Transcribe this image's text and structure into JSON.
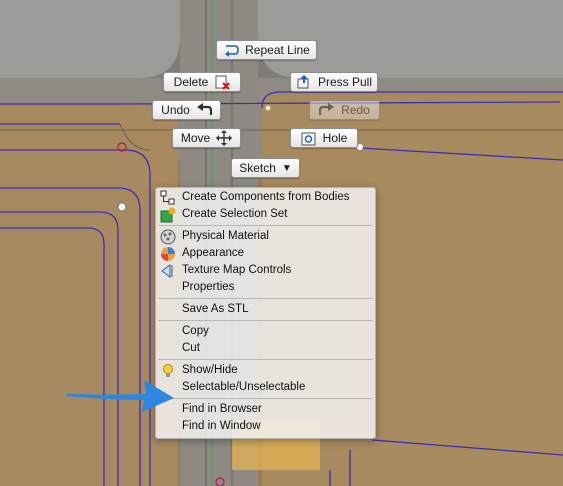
{
  "marking_menu": {
    "repeat_label": "Repeat Line",
    "delete_label": "Delete",
    "press_pull_label": "Press Pull",
    "undo_label": "Undo",
    "redo_label": "Redo",
    "move_label": "Move",
    "hole_label": "Hole",
    "sketch_label": "Sketch"
  },
  "context_menu": {
    "items": [
      {
        "label": "Create Components from Bodies",
        "icon": "components-icon"
      },
      {
        "label": "Create Selection Set",
        "icon": "selection-set-icon"
      },
      {
        "label": "Physical Material",
        "icon": "physical-material-icon"
      },
      {
        "label": "Appearance",
        "icon": "appearance-icon"
      },
      {
        "label": "Texture Map Controls",
        "icon": "texture-map-icon"
      },
      {
        "label": "Properties"
      },
      {
        "label": "Save As STL"
      },
      {
        "label": "Copy"
      },
      {
        "label": "Cut"
      },
      {
        "label": "Show/Hide",
        "icon": "lightbulb-icon"
      },
      {
        "label": "Selectable/Unselectable"
      },
      {
        "label": "Find in Browser"
      },
      {
        "label": "Find in Window"
      }
    ]
  },
  "colors": {
    "surface": "#a88a60",
    "edge_line": "#3a2fb0",
    "gray_fill": "#8d8c89",
    "arrow": "#2f86e0",
    "selection": "#e4b454"
  }
}
